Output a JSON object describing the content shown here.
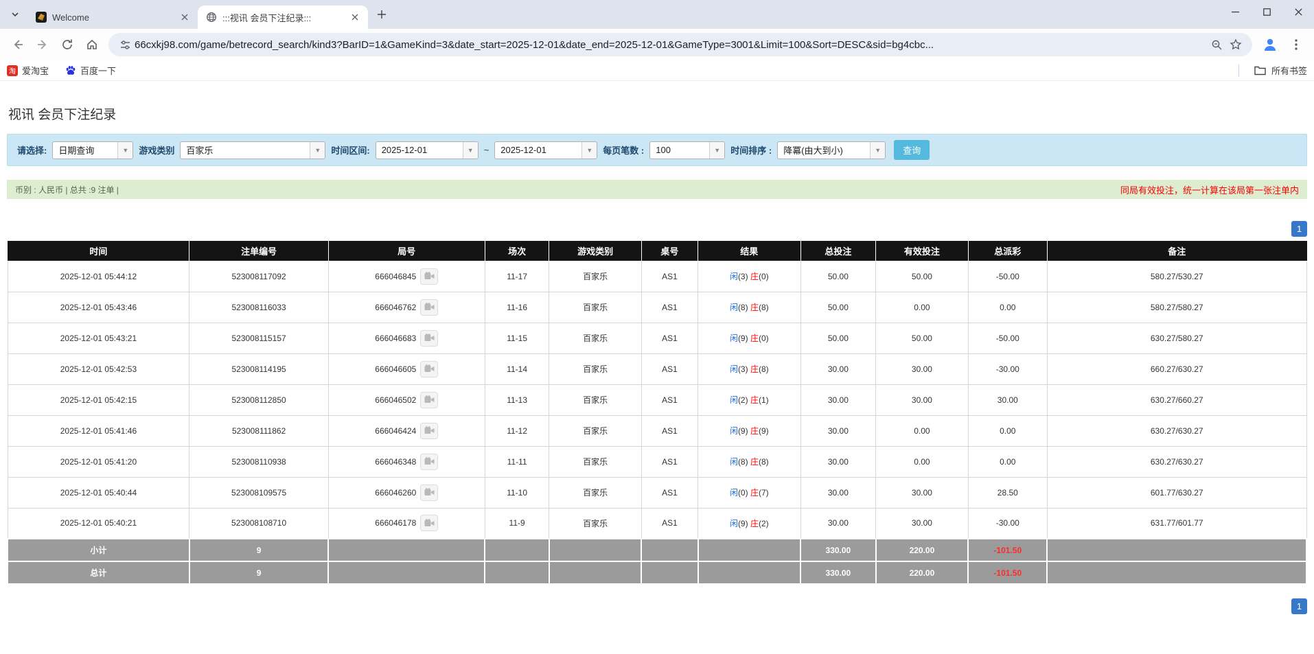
{
  "browser": {
    "tab_search_icon": "⌄",
    "tabs": [
      {
        "title": "Welcome"
      },
      {
        "title": ":::视讯 会员下注纪录:::"
      }
    ],
    "close_glyph": "✕",
    "new_tab_glyph": "+",
    "window": {
      "minimize": "—",
      "maximize": "▢",
      "close": "✕"
    },
    "url": "66cxkj98.com/game/betrecord_search/kind3?BarID=1&GameKind=3&date_start=2025-12-01&date_end=2025-12-01&GameType=3001&Limit=100&Sort=DESC&sid=bg4cbc...",
    "bookmarks": [
      {
        "label": "爱淘宝",
        "badge": "淘"
      },
      {
        "label": "百度一下"
      }
    ],
    "all_bookmarks_label": "所有书签"
  },
  "page": {
    "title": "视讯 会员下注纪录",
    "filters": {
      "select_label": "请选择:",
      "select_value": "日期查询",
      "game_label": "游戏类别",
      "game_value": "百家乐",
      "range_label": "时间区间:",
      "date_start": "2025-12-01",
      "tilde": "~",
      "date_end": "2025-12-01",
      "per_page_label": "每页笔数 :",
      "per_page_value": "100",
      "sort_label": "时间排序 :",
      "sort_value": "降冪(由大到小)",
      "search_button": "查询"
    },
    "info_bar": {
      "left": "币别 : 人民币 | 总共 :9 注单 |",
      "right": "同局有效投注，统一计算在该局第一张注单内"
    },
    "pagination": {
      "page": "1"
    },
    "table": {
      "headers": [
        "时间",
        "注单编号",
        "局号",
        "场次",
        "游戏类别",
        "桌号",
        "结果",
        "总投注",
        "有效投注",
        "总派彩",
        "备注"
      ],
      "result_labels": {
        "player": "闲",
        "banker": "庄"
      },
      "rows": [
        {
          "time": "2025-12-01 05:44:12",
          "bet_id": "523008117092",
          "round_id": "666046845",
          "session": "11-17",
          "game": "百家乐",
          "table_no": "AS1",
          "result": {
            "player": "3",
            "banker": "0"
          },
          "total_bet": "50.00",
          "valid_bet": "50.00",
          "payout": "-50.00",
          "remark": "580.27/530.27"
        },
        {
          "time": "2025-12-01 05:43:46",
          "bet_id": "523008116033",
          "round_id": "666046762",
          "session": "11-16",
          "game": "百家乐",
          "table_no": "AS1",
          "result": {
            "player": "8",
            "banker": "8"
          },
          "total_bet": "50.00",
          "valid_bet": "0.00",
          "payout": "0.00",
          "remark": "580.27/580.27"
        },
        {
          "time": "2025-12-01 05:43:21",
          "bet_id": "523008115157",
          "round_id": "666046683",
          "session": "11-15",
          "game": "百家乐",
          "table_no": "AS1",
          "result": {
            "player": "9",
            "banker": "0"
          },
          "total_bet": "50.00",
          "valid_bet": "50.00",
          "payout": "-50.00",
          "remark": "630.27/580.27"
        },
        {
          "time": "2025-12-01 05:42:53",
          "bet_id": "523008114195",
          "round_id": "666046605",
          "session": "11-14",
          "game": "百家乐",
          "table_no": "AS1",
          "result": {
            "player": "3",
            "banker": "8"
          },
          "total_bet": "30.00",
          "valid_bet": "30.00",
          "payout": "-30.00",
          "remark": "660.27/630.27"
        },
        {
          "time": "2025-12-01 05:42:15",
          "bet_id": "523008112850",
          "round_id": "666046502",
          "session": "11-13",
          "game": "百家乐",
          "table_no": "AS1",
          "result": {
            "player": "2",
            "banker": "1"
          },
          "total_bet": "30.00",
          "valid_bet": "30.00",
          "payout": "30.00",
          "remark": "630.27/660.27"
        },
        {
          "time": "2025-12-01 05:41:46",
          "bet_id": "523008111862",
          "round_id": "666046424",
          "session": "11-12",
          "game": "百家乐",
          "table_no": "AS1",
          "result": {
            "player": "9",
            "banker": "9"
          },
          "total_bet": "30.00",
          "valid_bet": "0.00",
          "payout": "0.00",
          "remark": "630.27/630.27"
        },
        {
          "time": "2025-12-01 05:41:20",
          "bet_id": "523008110938",
          "round_id": "666046348",
          "session": "11-11",
          "game": "百家乐",
          "table_no": "AS1",
          "result": {
            "player": "8",
            "banker": "8"
          },
          "total_bet": "30.00",
          "valid_bet": "0.00",
          "payout": "0.00",
          "remark": "630.27/630.27"
        },
        {
          "time": "2025-12-01 05:40:44",
          "bet_id": "523008109575",
          "round_id": "666046260",
          "session": "11-10",
          "game": "百家乐",
          "table_no": "AS1",
          "result": {
            "player": "0",
            "banker": "7"
          },
          "total_bet": "30.00",
          "valid_bet": "30.00",
          "payout": "28.50",
          "remark": "601.77/630.27"
        },
        {
          "time": "2025-12-01 05:40:21",
          "bet_id": "523008108710",
          "round_id": "666046178",
          "session": "11-9",
          "game": "百家乐",
          "table_no": "AS1",
          "result": {
            "player": "9",
            "banker": "2"
          },
          "total_bet": "30.00",
          "valid_bet": "30.00",
          "payout": "-30.00",
          "remark": "631.77/601.77"
        }
      ],
      "subtotal": {
        "label": "小计",
        "count": "9",
        "total_bet": "330.00",
        "valid_bet": "220.00",
        "payout": "-101.50"
      },
      "total": {
        "label": "总计",
        "count": "9",
        "total_bet": "330.00",
        "valid_bet": "220.00",
        "payout": "-101.50"
      }
    }
  }
}
